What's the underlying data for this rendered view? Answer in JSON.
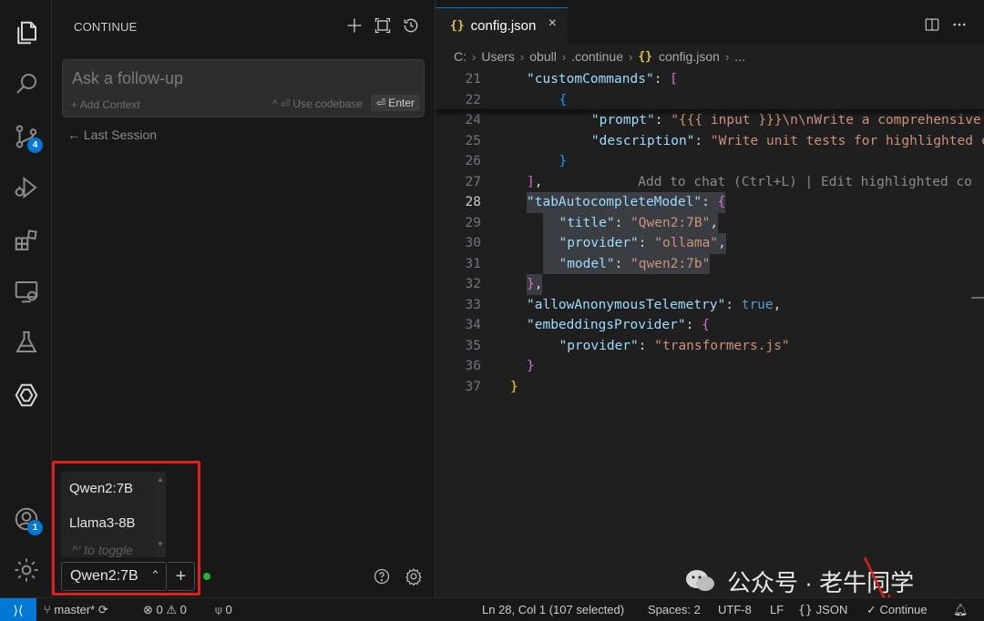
{
  "sidebar": {
    "header": "CONTINUE",
    "input": {
      "placeholder": "Ask a follow-up",
      "add_context": "+ Add Context",
      "use_codebase": "^ ⏎ Use codebase",
      "enter": "⏎ Enter"
    },
    "last_session": "← Last Session",
    "model_dropdown": {
      "options": [
        "Qwen2:7B",
        "Llama3-8B"
      ],
      "hint": "^' to toggle"
    },
    "model_select": {
      "value": "Qwen2:7B",
      "add": "+"
    }
  },
  "activity_bar": {
    "icons": [
      "explorer-icon",
      "search-icon",
      "source-control-icon",
      "run-debug-icon",
      "extensions-icon",
      "remote-explorer-icon",
      "testing-icon",
      "continue-icon",
      "account-icon",
      "manage-gear-icon"
    ],
    "source_control_badge": "4",
    "account_badge": "1"
  },
  "editor": {
    "tab": {
      "title": "config.json",
      "close": "×"
    },
    "breadcrumb": [
      "C:",
      "Users",
      "obull",
      ".continue",
      "config.json",
      "..."
    ],
    "lines": [
      {
        "n": "21",
        "html": "<span class=\"k\">\"customCommands\"</span><span class=\"p\">: </span><span class=\"b1\">[</span>"
      },
      {
        "n": "22",
        "html": "  <span class=\"b2\">{</span>"
      },
      {
        "n": "24",
        "html": "    <span class=\"k\">\"prompt\"</span><span class=\"p\">: </span><span class=\"s\">\"{{{ input }}}\\n\\nWrite a comprehensive s</span>"
      },
      {
        "n": "25",
        "html": "    <span class=\"k\">\"description\"</span><span class=\"p\">: </span><span class=\"s\">\"Write unit tests for highlighted co</span>"
      },
      {
        "n": "26",
        "html": "  <span class=\"b2\">}</span>"
      },
      {
        "n": "27",
        "html": "<span class=\"b1\">]</span><span class=\"p\">,</span>            <span class=\"ghost\">Add to chat (Ctrl+L) | Edit highlighted co</span>"
      },
      {
        "n": "28",
        "html": "<span class=\"k\">\"tabAutocompleteModel\"</span><span class=\"p\">: </span><span class=\"b1\">{</span>"
      },
      {
        "n": "29",
        "html": "  <span class=\"k\">\"title\"</span><span class=\"p\">: </span><span class=\"s\">\"Qwen2:7B\"</span><span class=\"p\">,</span>"
      },
      {
        "n": "30",
        "html": "  <span class=\"k\">\"provider\"</span><span class=\"p\">: </span><span class=\"s\">\"ollama\"</span><span class=\"p\">,</span>"
      },
      {
        "n": "31",
        "html": "  <span class=\"k\">\"model\"</span><span class=\"p\">: </span><span class=\"s\">\"qwen2:7b\"</span>"
      },
      {
        "n": "32",
        "html": "<span class=\"b1\">}</span><span class=\"p\">,</span>"
      },
      {
        "n": "33",
        "html": "<span class=\"k\">\"allowAnonymousTelemetry\"</span><span class=\"p\">: </span><span class=\"bool\">true</span><span class=\"p\">,</span>"
      },
      {
        "n": "34",
        "html": "<span class=\"k\">\"embeddingsProvider\"</span><span class=\"p\">: </span><span class=\"b1\">{</span>"
      },
      {
        "n": "35",
        "html": "  <span class=\"k\">\"provider\"</span><span class=\"p\">: </span><span class=\"s\">\"transformers.js\"</span>"
      },
      {
        "n": "36",
        "html": "<span class=\"b1\">}</span>"
      },
      {
        "n": "37",
        "html": "<span class=\"b0\">}</span>"
      }
    ],
    "current_line": "28"
  },
  "status_bar": {
    "branch": "master*",
    "errors": "0",
    "warnings": "0",
    "ports": "0",
    "cursor": "Ln 28, Col 1 (107 selected)",
    "spaces": "Spaces: 2",
    "encoding": "UTF-8",
    "eol": "LF",
    "language": "JSON",
    "continue": "✓ Continue"
  },
  "watermark": "公众号 · 老牛同学",
  "colors": {
    "accent": "#0078d4",
    "highlight_box": "#e21d1d",
    "status_dot": "#1fb33a"
  }
}
